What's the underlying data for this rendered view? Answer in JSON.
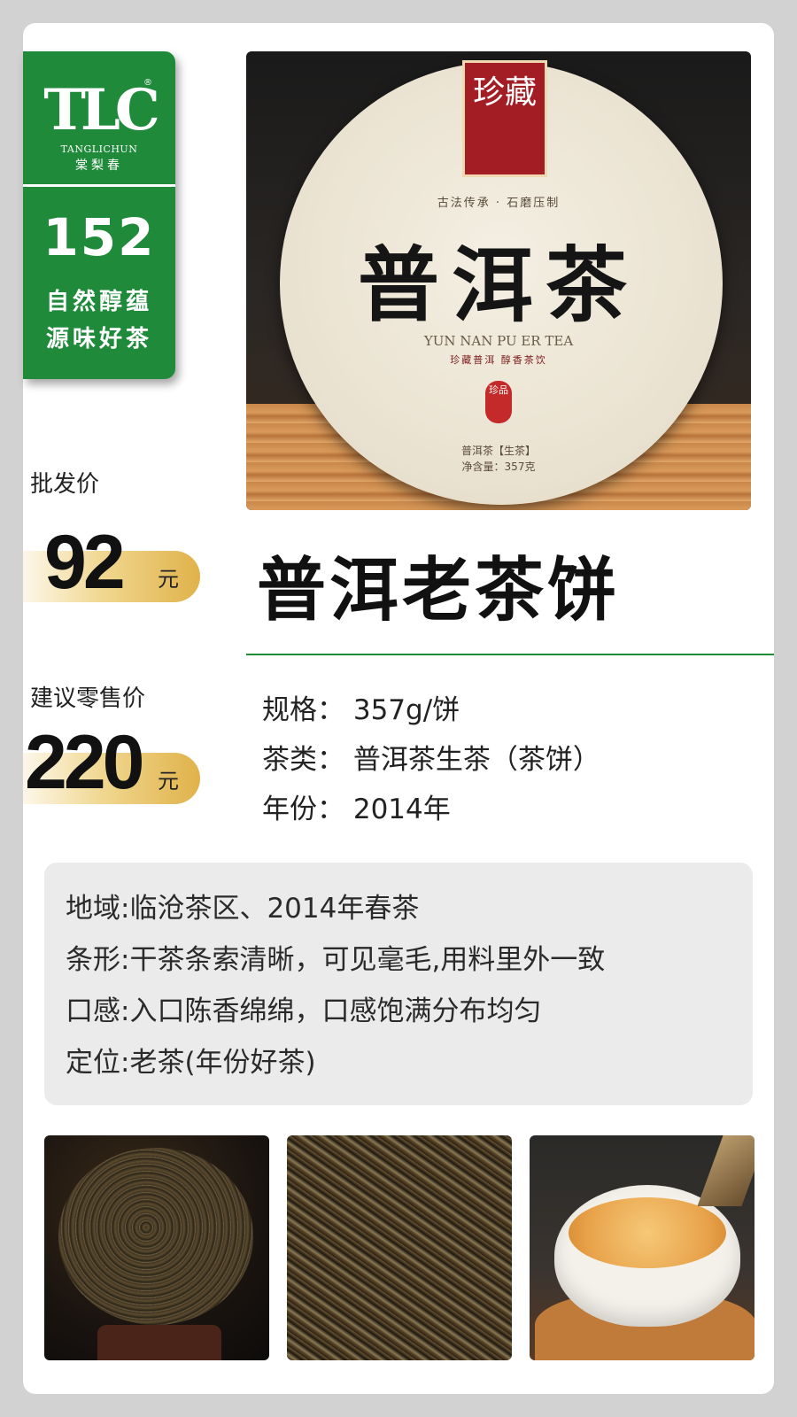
{
  "brand": {
    "logo_letters": "TLC",
    "registered": "®",
    "name_en": "TANGLICHUN",
    "name_cn": "棠梨春"
  },
  "badge": {
    "number": "152",
    "slogan_line1": "自然醇蕴",
    "slogan_line2": "源味好茶"
  },
  "hero": {
    "seal_text": "珍藏",
    "motto": "古法传承 · 石磨压制",
    "title": "普洱茶",
    "pinyin": "YUN NAN PU ER TEA",
    "subtitle": "珍藏普洱 醇香茶饮",
    "stamp": "珍品",
    "spec_type": "普洱茶【生茶】",
    "spec_weight": "净含量：357克"
  },
  "prices": {
    "wholesale_label": "批发价",
    "wholesale_value": "92",
    "retail_label": "建议零售价",
    "retail_value": "220",
    "unit": "元"
  },
  "product": {
    "title": "普洱老茶饼",
    "specs": [
      "规格：  357g/饼",
      "茶类：  普洱茶生茶（茶饼）",
      "年份：  2014年"
    ]
  },
  "details": [
    "地域:临沧茶区、2014年春茶",
    "条形:干茶条索清晰，可见毫毛,用料里外一致",
    "口感:入口陈香绵绵，口感饱满分布均匀",
    "定位:老茶(年份好茶)"
  ],
  "colors": {
    "brand_green": "#1e8a3a",
    "gold": "#e0b24a",
    "background": "#d2d2d2"
  }
}
